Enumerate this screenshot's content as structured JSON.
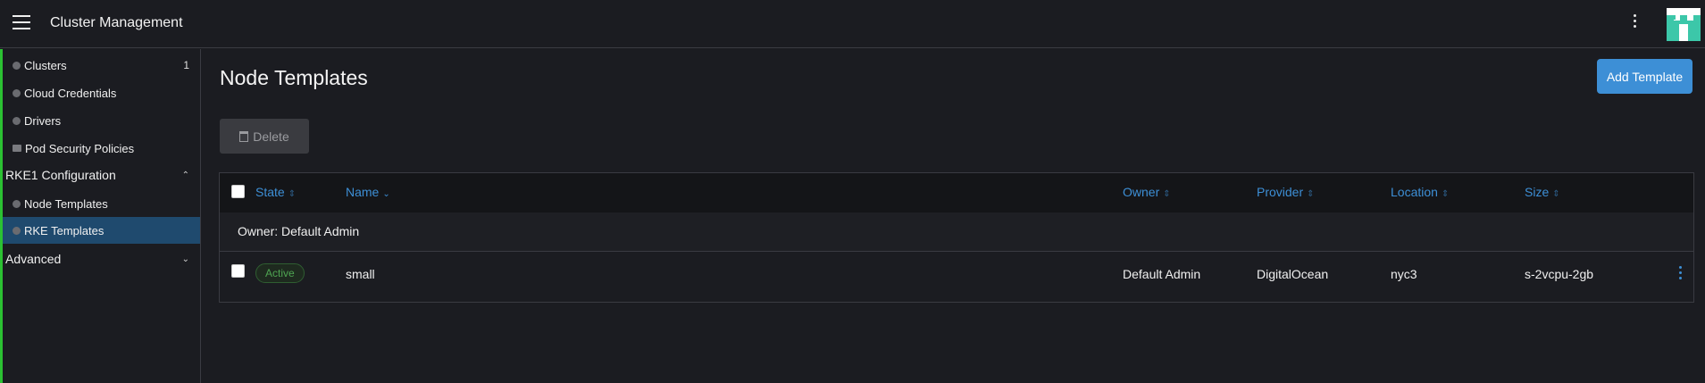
{
  "header": {
    "title": "Cluster Management"
  },
  "sidebar": {
    "items": [
      {
        "label": "Clusters",
        "count": "1"
      },
      {
        "label": "Cloud Credentials"
      },
      {
        "label": "Drivers"
      },
      {
        "label": "Pod Security Policies"
      }
    ],
    "groups": [
      {
        "label": "RKE1 Configuration",
        "chevron": "⌃"
      },
      {
        "label": "Advanced",
        "chevron": "⌄"
      }
    ],
    "rke1_items": [
      {
        "label": "Node Templates"
      },
      {
        "label": "RKE Templates",
        "active": true
      }
    ]
  },
  "main": {
    "title": "Node Templates",
    "add_button": "Add Template",
    "delete_button": "Delete"
  },
  "table": {
    "columns": [
      {
        "label": "State",
        "sort": "⇕"
      },
      {
        "label": "Name",
        "sort": "⌄"
      },
      {
        "label": "Owner",
        "sort": "⇕"
      },
      {
        "label": "Provider",
        "sort": "⇕"
      },
      {
        "label": "Location",
        "sort": "⇕"
      },
      {
        "label": "Size",
        "sort": "⇕"
      }
    ],
    "group_label": "Owner: Default Admin",
    "rows": [
      {
        "state": "Active",
        "name": "small",
        "owner": "Default Admin",
        "provider": "DigitalOcean",
        "location": "nyc3",
        "size": "s-2vcpu-2gb"
      }
    ]
  },
  "colors": {
    "accent": "#3d8fd6",
    "active_bg": "#1f4a6e",
    "status_green": "#4fa552",
    "edge_green": "#2bc132"
  }
}
